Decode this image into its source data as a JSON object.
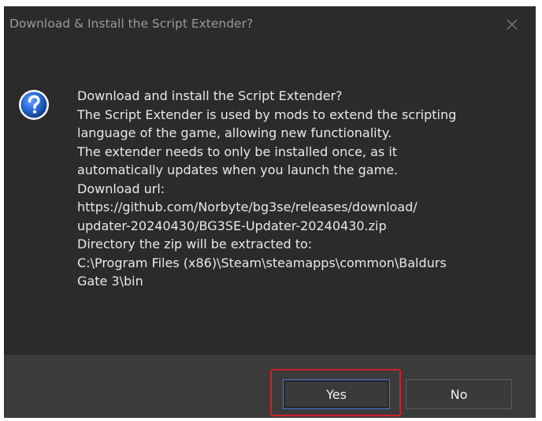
{
  "dialog": {
    "title": "Download & Install the Script Extender?",
    "close_icon": "close-icon",
    "question_icon": "question-icon",
    "message_lines": [
      "Download and install the Script Extender?",
      "The Script Extender is used by mods to extend the scripting",
      "language of the game, allowing new functionality.",
      "The extender needs to only be installed once, as it",
      "automatically updates when you launch the game.",
      "Download url:",
      "https://github.com/Norbyte/bg3se/releases/download/",
      "updater-20240430/BG3SE-Updater-20240430.zip",
      "Directory the zip will be extracted to:",
      "C:\\Program Files (x86)\\Steam\\steamapps\\common\\Baldurs",
      "Gate 3\\bin"
    ],
    "buttons": {
      "yes": "Yes",
      "no": "No"
    }
  },
  "colors": {
    "dialog_bg": "#2b2b2b",
    "footer_bg": "#3b3b3b",
    "title_text": "#9a9a9a",
    "message_text": "#e8e8e8",
    "yes_border": "#3f6fd1",
    "highlight": "#d0202a",
    "icon_blue": "#1f5fbf"
  }
}
